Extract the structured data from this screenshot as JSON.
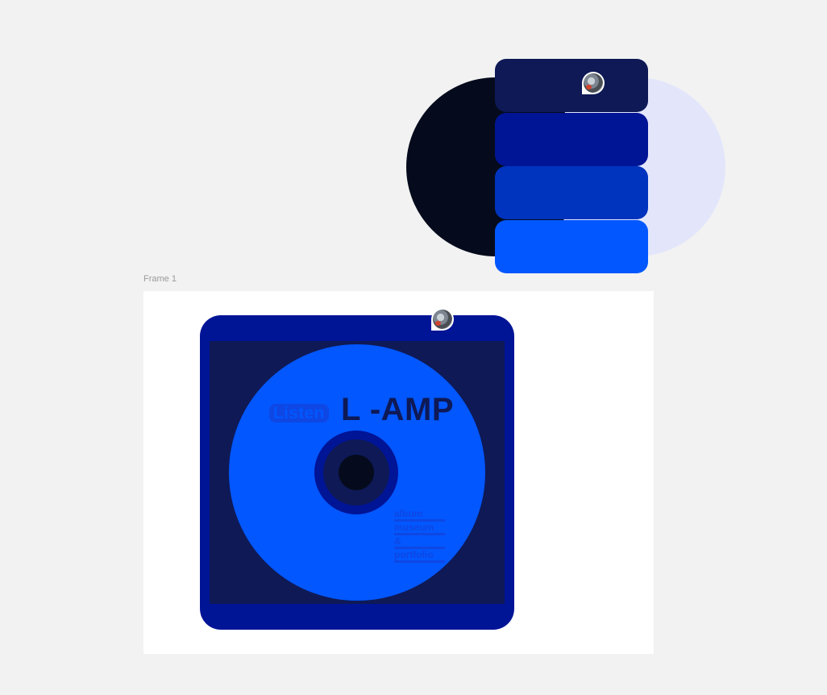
{
  "palette": {
    "colors": [
      "#0e1956",
      "#001496",
      "#0033be",
      "#0257fe"
    ],
    "background_circles": [
      "#050b1c",
      "#e3e6fb"
    ]
  },
  "frame": {
    "label": "Frame 1"
  },
  "cover": {
    "badge": "Listen",
    "title": "L -AMP",
    "subtitle_lines": [
      "album",
      "museum",
      "&",
      "portfolio"
    ]
  }
}
